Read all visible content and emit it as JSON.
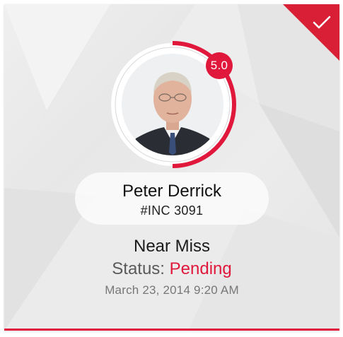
{
  "theme": {
    "accent": "#e0183c",
    "ring_background": "#ffffff"
  },
  "header": {
    "action_icon": "checkmark-icon"
  },
  "profile": {
    "rating": "5.0",
    "name": "Peter Derrick",
    "incident_id": "#INC 3091",
    "photo": "portrait-photo"
  },
  "incident": {
    "type": "Near Miss",
    "status_label": "Status:",
    "status_value": "Pending",
    "timestamp": "March 23, 2014 9:20 AM"
  }
}
